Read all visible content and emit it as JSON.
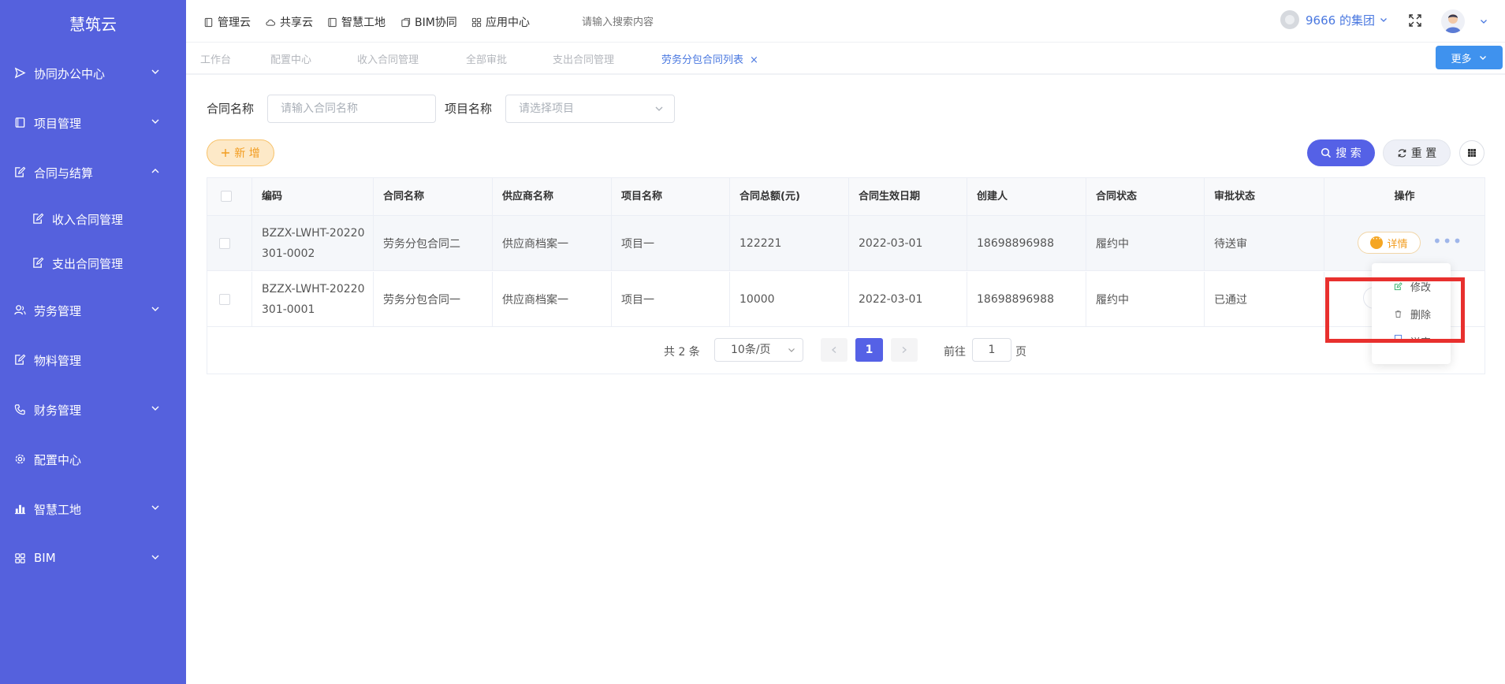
{
  "sidebar": {
    "logo": "慧筑云",
    "items": [
      {
        "label": "协同办公中心",
        "icon": "send-icon",
        "chevron": "down"
      },
      {
        "label": "项目管理",
        "icon": "book-icon",
        "chevron": "down"
      },
      {
        "label": "合同与结算",
        "icon": "edit-doc-icon",
        "chevron": "up"
      },
      {
        "label": "收入合同管理",
        "icon": "edit-doc-icon"
      },
      {
        "label": "支出合同管理",
        "icon": "edit-doc-icon"
      },
      {
        "label": "劳务管理",
        "icon": "users-icon",
        "chevron": "down"
      },
      {
        "label": "物料管理",
        "icon": "edit-doc-icon"
      },
      {
        "label": "财务管理",
        "icon": "phone-icon",
        "chevron": "down"
      },
      {
        "label": "配置中心",
        "icon": "gear-icon"
      },
      {
        "label": "智慧工地",
        "icon": "bar-chart-icon",
        "chevron": "down"
      },
      {
        "label": "BIM",
        "icon": "grid-icon",
        "chevron": "down"
      }
    ]
  },
  "topnav": {
    "items": [
      {
        "label": "管理云",
        "icon": "doc-icon"
      },
      {
        "label": "共享云",
        "icon": "cloud-icon"
      },
      {
        "label": "智慧工地",
        "icon": "book-icon"
      },
      {
        "label": "BIM协同",
        "icon": "cube-icon"
      },
      {
        "label": "应用中心",
        "icon": "apps-icon"
      }
    ],
    "search_placeholder": "请输入搜索内容",
    "group_name": "9666 的集团"
  },
  "tabs": [
    {
      "label": "工作台",
      "active": false
    },
    {
      "label": "配置中心",
      "active": false
    },
    {
      "label": "收入合同管理",
      "active": false
    },
    {
      "label": "全部审批",
      "active": false
    },
    {
      "label": "支出合同管理",
      "active": false
    },
    {
      "label": "劳务分包合同列表",
      "active": true
    }
  ],
  "tab_close": "×",
  "more_label": "更多",
  "filters": {
    "contract_name_label": "合同名称",
    "contract_name_placeholder": "请输入合同名称",
    "project_name_label": "项目名称",
    "project_name_placeholder": "请选择项目"
  },
  "buttons": {
    "add": "新 增",
    "search": "搜 索",
    "reset": "重 置"
  },
  "table": {
    "headers": [
      "编码",
      "合同名称",
      "供应商名称",
      "项目名称",
      "合同总额(元)",
      "合同生效日期",
      "创建人",
      "合同状态",
      "审批状态",
      "操作"
    ],
    "rows": [
      {
        "code": "BZZX-LWHT-20220301-0002",
        "name": "劳务分包合同二",
        "supplier": "供应商档案一",
        "project": "项目一",
        "amount": "122221",
        "date": "2022-03-01",
        "creator": "18698896988",
        "status": "履约中",
        "approval": "待送审"
      },
      {
        "code": "BZZX-LWHT-20220301-0001",
        "name": "劳务分包合同一",
        "supplier": "供应商档案一",
        "project": "项目一",
        "amount": "10000",
        "date": "2022-03-01",
        "creator": "18698896988",
        "status": "履约中",
        "approval": "已通过"
      }
    ],
    "detail_label": "详情",
    "more_ellipsis": "•••"
  },
  "dropdown": {
    "items": [
      "修改",
      "删除",
      "送审"
    ]
  },
  "pagination": {
    "total": "共 2 条",
    "page_size": "10条/页",
    "current": "1",
    "goto_label": "前往",
    "goto_value": "1",
    "page_unit": "页"
  },
  "colors": {
    "sidebar_bg": "#5561dd",
    "primary": "#5561e6",
    "accent_orange": "#f29c1f",
    "highlight_red": "#e8302e",
    "link_blue": "#4a78e0"
  }
}
